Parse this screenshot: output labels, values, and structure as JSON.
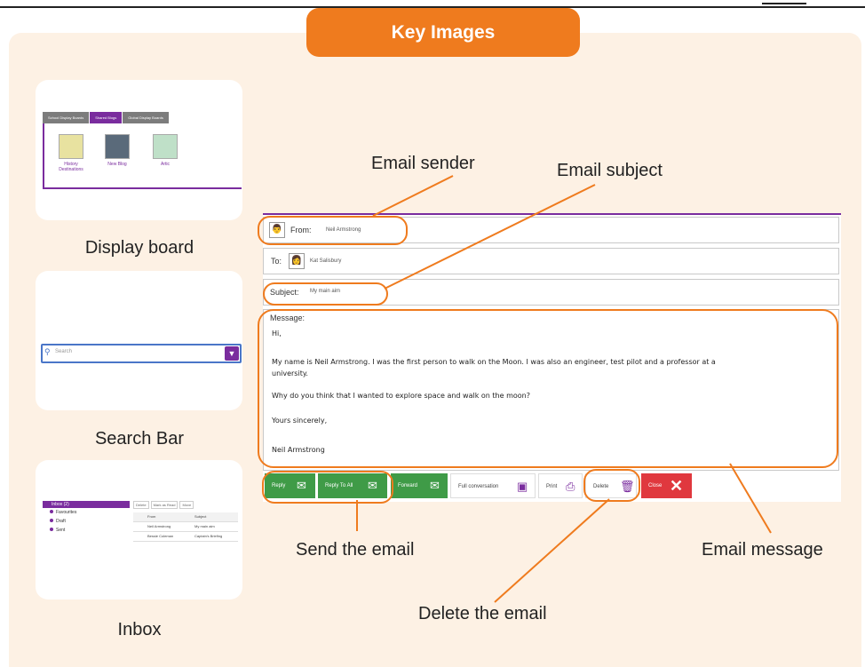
{
  "title": "Key Images",
  "display_board": {
    "caption": "Display board",
    "tabs": [
      "School Display Boards",
      "Shared Blogs",
      "Global Display Boards"
    ],
    "active_tab": "Shared Blogs",
    "items": [
      "History Destinations",
      "New Blog",
      "Artic"
    ]
  },
  "search_bar": {
    "caption": "Search Bar",
    "placeholder": "Search"
  },
  "inbox": {
    "caption": "Inbox",
    "header": "Inbox (2)",
    "folders": [
      "Favourites",
      "Draft",
      "Sent"
    ],
    "buttons": [
      "Delete",
      "Mark as Read",
      "Move"
    ],
    "columns": [
      "From",
      "Subject"
    ],
    "rows": [
      [
        "Neil Armstrong",
        "My main aim"
      ],
      [
        "Bessie Coleman",
        "Captain's Briefing"
      ]
    ]
  },
  "email": {
    "from_label": "From:",
    "from_value": "Neil Armstrong",
    "to_label": "To:",
    "to_value": "Kat Salisbury",
    "subject_label": "Subject:",
    "subject_value": "My main aim",
    "message_label": "Message:",
    "message_lines": [
      "Hi,",
      "My name is Neil Armstrong. I was the first person to walk on the Moon. I was also an engineer, test pilot and a professor at a",
      "university.",
      "Why do you think that I wanted to explore space and walk on the moon?",
      "Yours sincerely,",
      "Neil Armstrong"
    ],
    "buttons": {
      "reply": "Reply",
      "reply_all": "Reply To All",
      "forward": "Forward",
      "full_conversation": "Full conversation",
      "print": "Print",
      "delete": "Delete",
      "close": "Close"
    }
  },
  "annotations": {
    "sender": "Email sender",
    "subject": "Email subject",
    "send": "Send the email",
    "message": "Email message",
    "delete": "Delete the email"
  },
  "colors": {
    "accent_orange": "#ef7b1e",
    "panel_bg": "#fdf1e4",
    "purple": "#7a2c9e",
    "green": "#3f9b47",
    "red": "#e0383e"
  }
}
